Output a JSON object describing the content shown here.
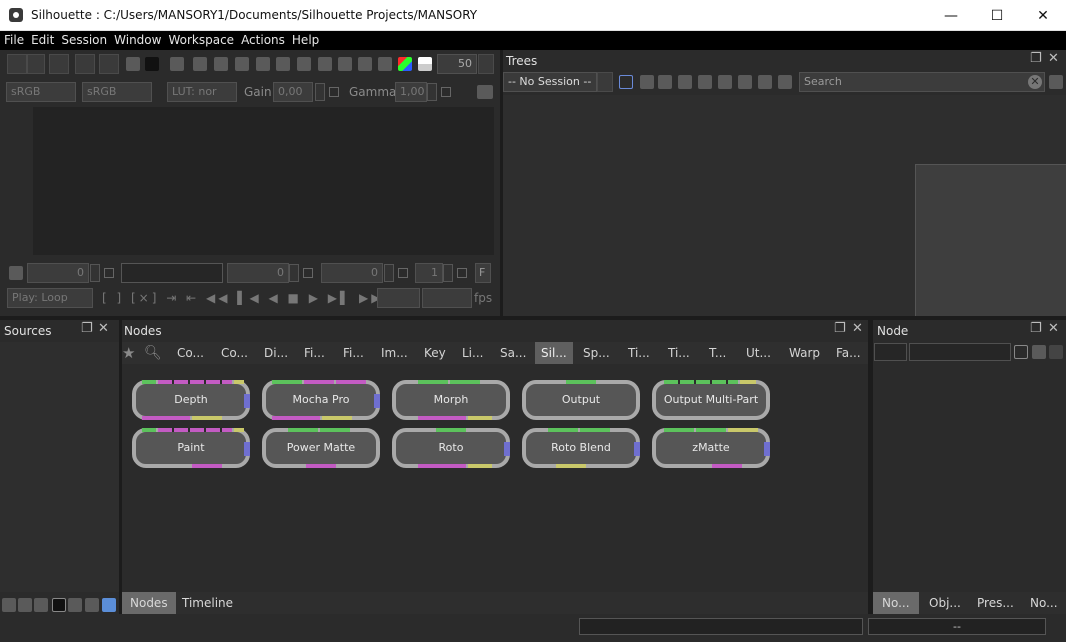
{
  "window": {
    "title": "Silhouette : C:/Users/MANSORY1/Documents/Silhouette Projects/MANSORY",
    "minimize": "—",
    "maximize": "☐",
    "close": "✕"
  },
  "menu": [
    "File",
    "Edit",
    "Session",
    "Window",
    "Workspace",
    "Actions",
    "Help"
  ],
  "viewer": {
    "zoom": "50",
    "colorspace_a": "sRGB",
    "colorspace_b": "sRGB",
    "lut": "LUT: nor",
    "gain_label": "Gain",
    "gain_value": "0,00",
    "gamma_label": "Gamma",
    "gamma_value": "1,00",
    "frame_a": "0",
    "frame_b": "0",
    "frame_c": "0",
    "frame_d": "1",
    "f_button": "F",
    "play_mode": "Play: Loop",
    "fps_label": "fps"
  },
  "trees": {
    "title": "Trees",
    "session_select": "-- No Session --",
    "search_placeholder": "Search"
  },
  "sources": {
    "title": "Sources"
  },
  "nodes_panel": {
    "title": "Nodes",
    "tabs": [
      "Co...",
      "Co...",
      "Di...",
      "Fi...",
      "Fi...",
      "Im...",
      "Key",
      "Li...",
      "Sa...",
      "Sil...",
      "Sp...",
      "Ti...",
      "Ti...",
      "T...",
      "Ut...",
      "Warp",
      "Fa..."
    ],
    "active_tab": "Sil...",
    "nodes": [
      "Depth",
      "Mocha Pro",
      "Morph",
      "Output",
      "Output Multi-Part",
      "Paint",
      "Power Matte",
      "Roto",
      "Roto Blend",
      "zMatte"
    ],
    "bottom_tabs": [
      "Nodes",
      "Timeline"
    ]
  },
  "node_panel": {
    "title": "Node",
    "bottom_tabs": [
      "No...",
      "Obj...",
      "Pres...",
      "No..."
    ]
  },
  "status": {
    "right_text": "--"
  },
  "colors": {
    "green": "#5cc25c",
    "magenta": "#c35bc3",
    "yellow": "#c9c86a",
    "blue": "#6f6fd0"
  }
}
